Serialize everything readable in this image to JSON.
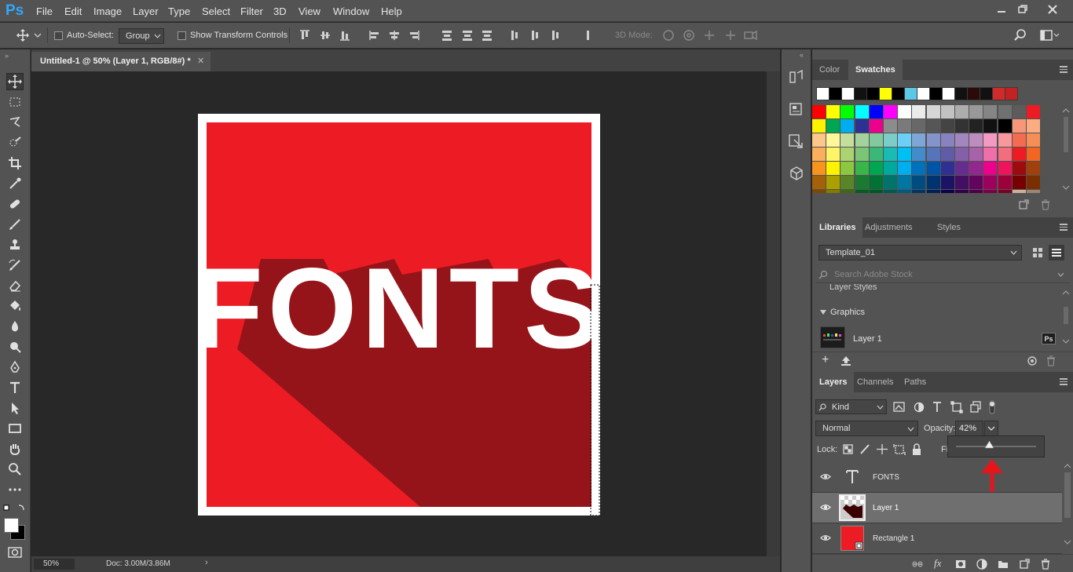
{
  "app": {
    "logo": "Ps"
  },
  "menu": [
    "File",
    "Edit",
    "Image",
    "Layer",
    "Type",
    "Select",
    "Filter",
    "3D",
    "View",
    "Window",
    "Help"
  ],
  "options": {
    "auto_select_label": "Auto-Select:",
    "auto_select_value": "Group",
    "show_transform_label": "Show Transform Controls",
    "mode_3d_label": "3D Mode:"
  },
  "document": {
    "tab_title": "Untitled-1 @ 50% (Layer 1, RGB/8#) *",
    "canvas_text": "FONTS",
    "zoom": "50%",
    "doc_size": "Doc: 3.00M/3.86M"
  },
  "colors": {
    "red": "#ed1c24",
    "shadow": "#95141a",
    "ps_blue": "#31a8ff",
    "arrow": "#e8141c"
  },
  "swatches_panel": {
    "tabs": [
      "Color",
      "Swatches"
    ],
    "active": "Swatches",
    "recent": [
      "#ffffff",
      "#000000",
      "#ffffff",
      "#111111",
      "#000000",
      "#ffff00",
      "#000000",
      "#5bc8e8",
      "#ffffff",
      "#000000",
      "#ffffff",
      "#111111",
      "#2b0a0a",
      "#111111",
      "#d02a2a",
      "#c42222"
    ],
    "grid": [
      [
        "#ff0000",
        "#ffff00",
        "#00ff00",
        "#00ffff",
        "#0000ff",
        "#ff00ff",
        "#ffffff",
        "#ebebeb",
        "#d6d6d6",
        "#c2c2c2",
        "#adadad",
        "#999999",
        "#858585",
        "#707070",
        "#5c5c5c",
        "#ed1c24"
      ],
      [
        "#fff200",
        "#00a651",
        "#00aeef",
        "#2e3192",
        "#ec008c",
        "#8c8c8c",
        "#7a7a7a",
        "#686868",
        "#565656",
        "#444444",
        "#333333",
        "#222222",
        "#111111",
        "#000000",
        "#f7977a",
        "#f9ad81"
      ],
      [
        "#fdc68a",
        "#fff79a",
        "#c4df9b",
        "#a3d39c",
        "#82ca9d",
        "#7bcdc8",
        "#6ecff6",
        "#7ea7d8",
        "#8493ca",
        "#8882be",
        "#a187be",
        "#bc8dbf",
        "#f49ac2",
        "#f6989d",
        "#f26c4f",
        "#f68e55"
      ],
      [
        "#fbaf5c",
        "#fff467",
        "#acd372",
        "#7cc576",
        "#3bb878",
        "#1abbb4",
        "#00bff3",
        "#438ccb",
        "#5574b9",
        "#605ca8",
        "#855fa8",
        "#a763a8",
        "#f06ea9",
        "#f26d7d",
        "#ed1c24",
        "#f26522"
      ],
      [
        "#f7941d",
        "#fff200",
        "#8dc73f",
        "#39b54a",
        "#00a651",
        "#00a99d",
        "#00aeef",
        "#0072bc",
        "#0054a6",
        "#2e3192",
        "#662d91",
        "#92278f",
        "#ec008c",
        "#ed145b",
        "#9e0b0f",
        "#a0410d"
      ],
      [
        "#a3620a",
        "#aba000",
        "#598527",
        "#1a7b30",
        "#007236",
        "#00746b",
        "#0076a3",
        "#004b80",
        "#003471",
        "#1b1464",
        "#440e62",
        "#630460",
        "#9e005d",
        "#9e0039",
        "#790000",
        "#7b2e00"
      ],
      [
        "#7d4900",
        "#827b00",
        "#406618",
        "#005e20",
        "#005826",
        "#005952",
        "#005b7f",
        "#003663",
        "#002157",
        "#0d004c",
        "#32004b",
        "#4b0049",
        "#7b0046",
        "#7a0026",
        "#c7b299",
        "#998675"
      ]
    ]
  },
  "libraries_panel": {
    "tabs": [
      "Libraries",
      "Adjustments",
      "Styles"
    ],
    "library": "Template_01",
    "search_placeholder": "Search Adobe Stock",
    "section_layer_styles": "Layer Styles",
    "section_graphics": "Graphics",
    "graphic_item": "Layer 1",
    "graphic_badge": "Ps"
  },
  "layers_panel": {
    "tabs": [
      "Layers",
      "Channels",
      "Paths"
    ],
    "filter": "Kind",
    "blend_mode": "Normal",
    "opacity_label": "Opacity:",
    "opacity_value": "42%",
    "opacity_fraction": 0.42,
    "lock_label": "Lock:",
    "fill_label": "Fi",
    "layers": [
      {
        "name": "FONTS",
        "kind": "text"
      },
      {
        "name": "Layer 1",
        "kind": "pixel",
        "selected": true
      },
      {
        "name": "Rectangle 1",
        "kind": "shape"
      }
    ]
  },
  "icons": [
    "move-icon",
    "marquee-icon",
    "lasso-icon",
    "quick-select-icon",
    "crop-icon",
    "eyedropper-icon",
    "healing-brush-icon",
    "brush-icon",
    "clone-stamp-icon",
    "history-brush-icon",
    "eraser-icon",
    "paint-bucket-icon",
    "blur-icon",
    "dodge-icon",
    "pen-icon",
    "type-icon",
    "path-select-icon",
    "rectangle-icon",
    "hand-icon",
    "zoom-icon",
    "more-tools-icon"
  ]
}
